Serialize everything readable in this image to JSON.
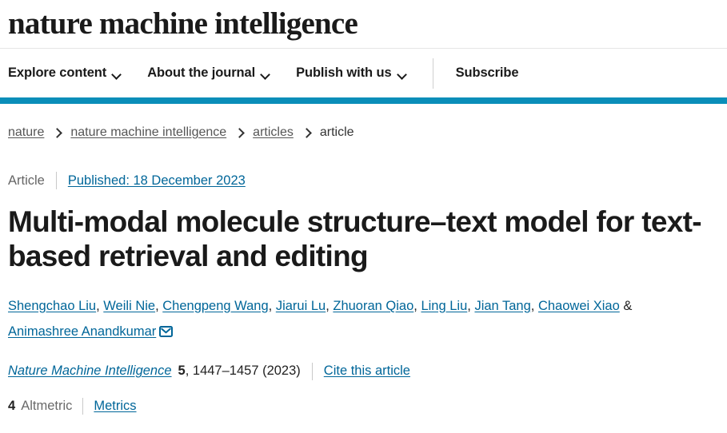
{
  "masthead": {
    "journal_name": "nature machine intelligence"
  },
  "nav": {
    "items": [
      {
        "label": "Explore content",
        "icon": "chevron-down-icon",
        "has_dropdown": true
      },
      {
        "label": "About the journal",
        "icon": "chevron-down-icon",
        "has_dropdown": true
      },
      {
        "label": "Publish with us",
        "icon": "chevron-down-icon",
        "has_dropdown": true
      }
    ],
    "subscribe_label": "Subscribe",
    "accent_color": "#0a8eb9"
  },
  "breadcrumb": {
    "items": [
      {
        "label": "nature",
        "is_link": true
      },
      {
        "label": "nature machine intelligence",
        "is_link": true
      },
      {
        "label": "articles",
        "is_link": true
      },
      {
        "label": "article",
        "is_link": false
      }
    ],
    "separator": "chevron-right-icon"
  },
  "kicker": {
    "article_type": "Article",
    "published": "Published: 18 December 2023"
  },
  "article": {
    "title": "Multi-modal molecule structure–text model for text-based retrieval and editing",
    "authors": [
      "Shengchao Liu",
      "Weili Nie",
      "Chengpeng Wang",
      "Jiarui Lu",
      "Zhuoran Qiao",
      "Ling Liu",
      "Jian Tang",
      "Chaowei Xiao"
    ],
    "author_conjunction": "&",
    "corresponding_author": "Animashree Anandkumar",
    "corresponding_icon": "envelope-icon"
  },
  "citation": {
    "journal": "Nature Machine Intelligence",
    "volume": "5",
    "pages": ", 1447–1457 (2023)",
    "cite_label": "Cite this article"
  },
  "metrics": {
    "altmetric_count": "4",
    "altmetric_label": "Altmetric",
    "metrics_label": "Metrics"
  },
  "colors": {
    "accent": "#0a8eb9",
    "link": "#006699",
    "text": "#1a1a1a",
    "muted": "#6a6a6a"
  }
}
